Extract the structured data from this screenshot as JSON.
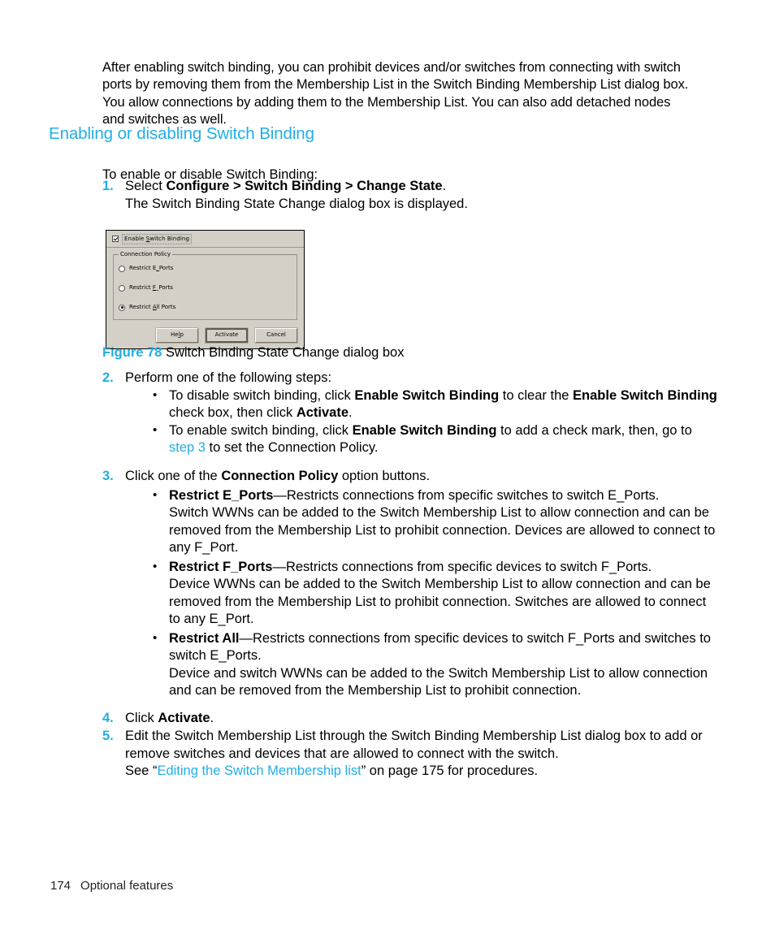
{
  "intro_paragraph": "After enabling switch binding, you can prohibit devices and/or switches from connecting with switch ports by removing them from the Membership List in the Switch Binding Membership List dialog box. You allow connections by adding them to the Membership List. You can also add detached nodes and switches as well.",
  "section_heading": "Enabling or disabling Switch Binding",
  "lead_in": "To enable or disable Switch Binding:",
  "steps": {
    "s1": {
      "num": "1.",
      "text_before": "Select ",
      "bold": "Configure > Switch Binding > Change State",
      "text_after": ".",
      "subline": "The Switch Binding State Change dialog box is displayed."
    },
    "s2": {
      "num": "2.",
      "text": "Perform one of the following steps:",
      "bullets": {
        "b1": {
          "p1": "To disable switch binding, click ",
          "b1bold": "Enable Switch Binding",
          "p2": " to clear the ",
          "b2bold": "Enable Switch Binding",
          "p3": " check box, then click ",
          "b3bold": "Activate",
          "p4": "."
        },
        "b2": {
          "p1": "To enable switch binding, click ",
          "b1bold": "Enable Switch Binding",
          "p2": " to add a check mark, then, go to ",
          "link": "step 3",
          "p3": " to set the Connection Policy."
        }
      }
    },
    "s3": {
      "num": "3.",
      "text_before": "Click one of the ",
      "bold": "Connection Policy",
      "text_after": " option buttons.",
      "bullets": [
        {
          "term": "Restrict E_Ports",
          "dash": "—",
          "definition": "Restricts connections from specific switches to switch E_Ports.",
          "body": "Switch WWNs can be added to the Switch Membership List to allow connection and can be removed from the Membership List to prohibit connection. Devices are allowed to connect to any F_Port."
        },
        {
          "term": "Restrict F_Ports",
          "dash": "—",
          "definition": "Restricts connections from specific devices to switch F_Ports.",
          "body": "Device WWNs can be added to the Switch Membership List to allow connection and can be removed from the Membership List to prohibit connection. Switches are allowed to connect to any E_Port."
        },
        {
          "term": "Restrict All",
          "dash": "—",
          "definition": "Restricts connections from specific devices to switch F_Ports and switches to switch E_Ports.",
          "body": "Device and switch WWNs can be added to the Switch Membership List to allow connection and can be removed from the Membership List to prohibit connection."
        }
      ]
    },
    "s4": {
      "num": "4.",
      "text_before": "Click ",
      "bold": "Activate",
      "text_after": "."
    },
    "s5": {
      "num": "5.",
      "text": "Edit the Switch Membership List through the Switch Binding Membership List dialog box to add or remove switches and devices that are allowed to connect with the switch.",
      "see_prefix": "See “",
      "see_link": "Editing the Switch Membership list",
      "see_suffix": "” on page 175 for procedures."
    }
  },
  "figure": {
    "caption_label": "Figure 78",
    "caption_text": "Switch Binding State Change dialog box",
    "dialog": {
      "checkbox_label_pre": "Enable ",
      "checkbox_label_u": "S",
      "checkbox_label_post": "witch Binding",
      "checkbox_checked": true,
      "group_title": "Connection Policy",
      "radios": [
        {
          "pre": "Restrict E",
          "u": "_",
          "post": "Ports",
          "label": "Restrict E_Ports",
          "selected": false
        },
        {
          "pre": "Restrict ",
          "u": "F",
          "post": "_Ports",
          "label": "Restrict F_Ports",
          "selected": false
        },
        {
          "pre": "Restrict ",
          "u": "A",
          "post": "ll Ports",
          "label": "Restrict All Ports",
          "selected": true
        }
      ],
      "buttons": [
        {
          "pre": "He",
          "u": "l",
          "post": "p",
          "label": "Help",
          "default": false
        },
        {
          "pre": "Activate",
          "u": "",
          "post": "",
          "label": "Activate",
          "default": true
        },
        {
          "pre": "Cancel",
          "u": "",
          "post": "",
          "label": "Cancel",
          "default": false
        }
      ]
    }
  },
  "footer": {
    "page_number": "174",
    "section_name": "Optional features"
  },
  "colors": {
    "accent": "#22AEE5",
    "text": "#000000",
    "dialog_face": "#D4D0C8"
  }
}
